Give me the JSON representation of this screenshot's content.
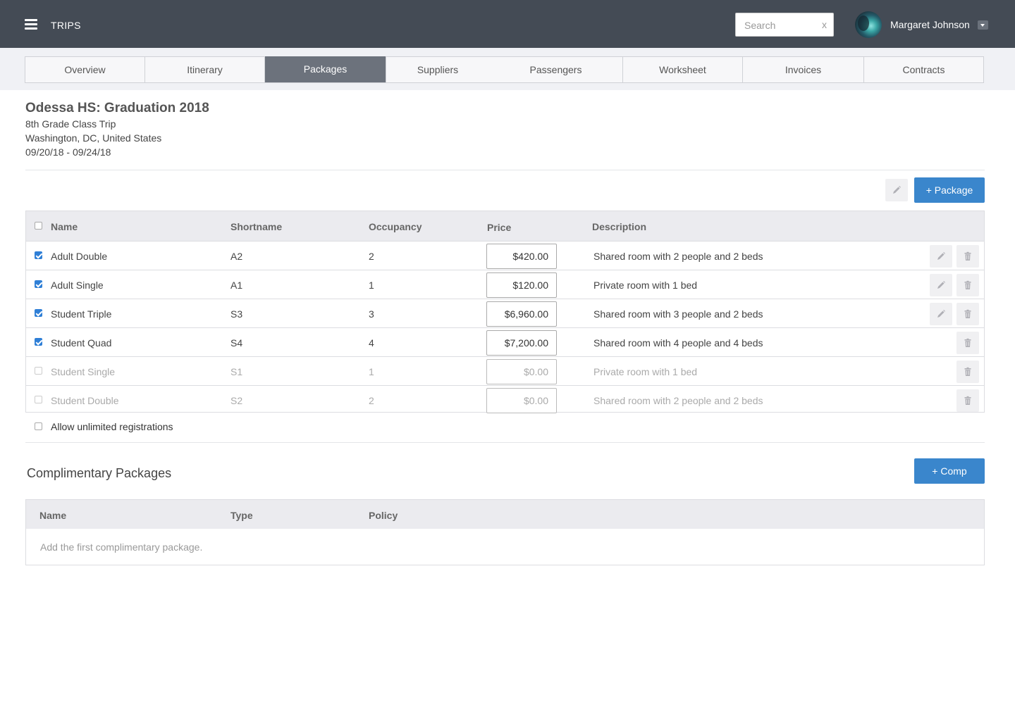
{
  "app": {
    "brand": "TRIPS"
  },
  "search": {
    "placeholder": "Search",
    "clear_label": "x"
  },
  "user": {
    "name": "Margaret Johnson"
  },
  "tabs": [
    {
      "label": "Overview"
    },
    {
      "label": "Itinerary"
    },
    {
      "label": "Packages"
    },
    {
      "label": "Suppliers"
    },
    {
      "label": "Passengers"
    },
    {
      "label": "Worksheet"
    },
    {
      "label": "Invoices"
    },
    {
      "label": "Contracts"
    }
  ],
  "active_tab": "Packages",
  "trip": {
    "title": "Odessa HS: Graduation 2018",
    "subtitle": "8th Grade Class Trip",
    "location": "Washington, DC, United States",
    "dates": "09/20/18 - 09/24/18"
  },
  "packages": {
    "add_label": "+ Package",
    "columns": {
      "name": "Name",
      "shortname": "Shortname",
      "occupancy": "Occupancy",
      "price": "Price",
      "description": "Description"
    },
    "rows": [
      {
        "checked": true,
        "name": "Adult Double",
        "shortname": "A2",
        "occupancy": "2",
        "price": "$420.00",
        "description": "Shared room with 2 people and 2 beds",
        "editable": true
      },
      {
        "checked": true,
        "name": "Adult Single",
        "shortname": "A1",
        "occupancy": "1",
        "price": "$120.00",
        "description": "Private room with 1 bed",
        "editable": true
      },
      {
        "checked": true,
        "name": "Student Triple",
        "shortname": "S3",
        "occupancy": "3",
        "price": "$6,960.00",
        "description": "Shared room with 3 people and 2 beds",
        "editable": true
      },
      {
        "checked": true,
        "name": "Student Quad",
        "shortname": "S4",
        "occupancy": "4",
        "price": "$7,200.00",
        "description": "Shared room with 4 people and 4 beds",
        "editable": false
      },
      {
        "checked": false,
        "name": "Student Single",
        "shortname": "S1",
        "occupancy": "1",
        "price": "$0.00",
        "description": "Private room with 1 bed",
        "editable": false
      },
      {
        "checked": false,
        "name": "Student Double",
        "shortname": "S2",
        "occupancy": "2",
        "price": "$0.00",
        "description": "Shared room with 2 people and 2 beds",
        "editable": false
      }
    ],
    "allow_unlimited_label": "Allow unlimited registrations"
  },
  "complimentary": {
    "title": "Complimentary Packages",
    "add_label": "+ Comp",
    "columns": {
      "name": "Name",
      "type": "Type",
      "policy": "Policy"
    },
    "empty_message": "Add the first complimentary package."
  },
  "colors": {
    "topbar": "#444b55",
    "accent": "#3a86cc",
    "active_tab": "#6c727c"
  },
  "icons": {
    "menu": "hamburger-icon",
    "edit": "pencil-icon",
    "delete": "trash-icon",
    "caret": "chevron-down-icon"
  }
}
